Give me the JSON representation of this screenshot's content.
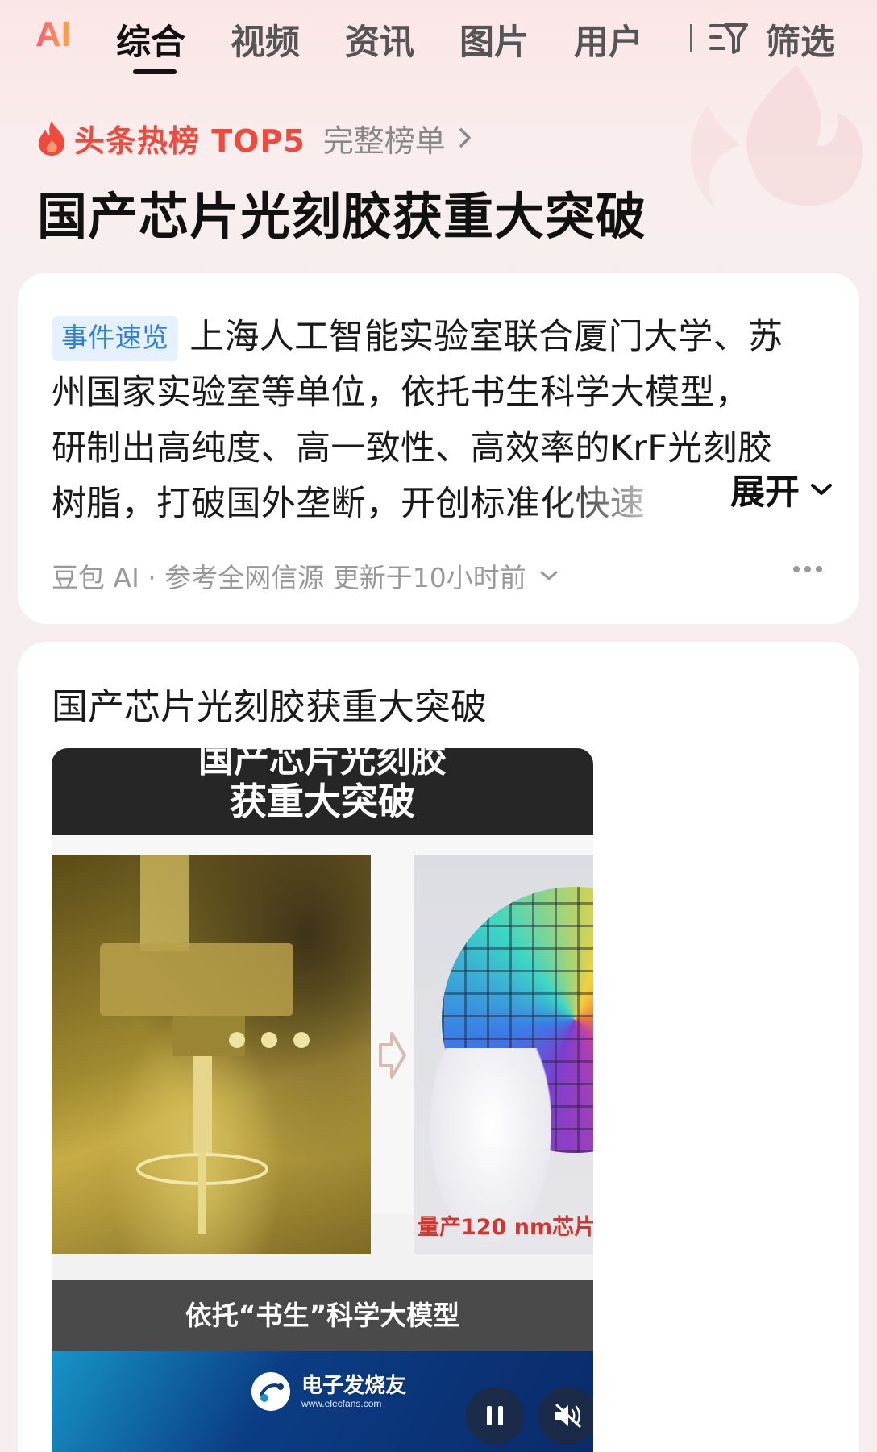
{
  "tabs": {
    "ai_label": "AI",
    "items": [
      "综合",
      "视频",
      "资讯",
      "图片",
      "用户"
    ],
    "active": "综合",
    "filter_label": "筛选"
  },
  "hot": {
    "label": "头条热榜 TOP5",
    "full_list": "完整榜单",
    "headline": "国产芯片光刻胶获重大突破"
  },
  "summary_card": {
    "badge": "事件速览",
    "lines": [
      "上海人工智能实验室联合厦门大学、苏",
      "州国家实验室等单位，依托书生科学大模型，",
      "研制出高纯度、高一致性、高效率的KrF光刻胶",
      "树脂，打破国外垄断，开创标准化快速"
    ],
    "expand_label": "展开",
    "meta": "豆包 AI · 参考全网信源 更新于10小时前"
  },
  "video_card": {
    "title": "国产芯片光刻胶获重大突破",
    "video_title_line1": "国产芯片光刻胶",
    "video_title_line2": "获重大突破",
    "wafer_caption": "量产120 nm芯片",
    "subtitle": "依托“书生”科学大模型",
    "brand_name": "电子发烧友",
    "brand_url": "www.elecfans.com"
  },
  "colors": {
    "accent_red": "#f04a3c",
    "badge_blue": "#2d7fe8",
    "badge_bg": "#e6f1fd"
  }
}
